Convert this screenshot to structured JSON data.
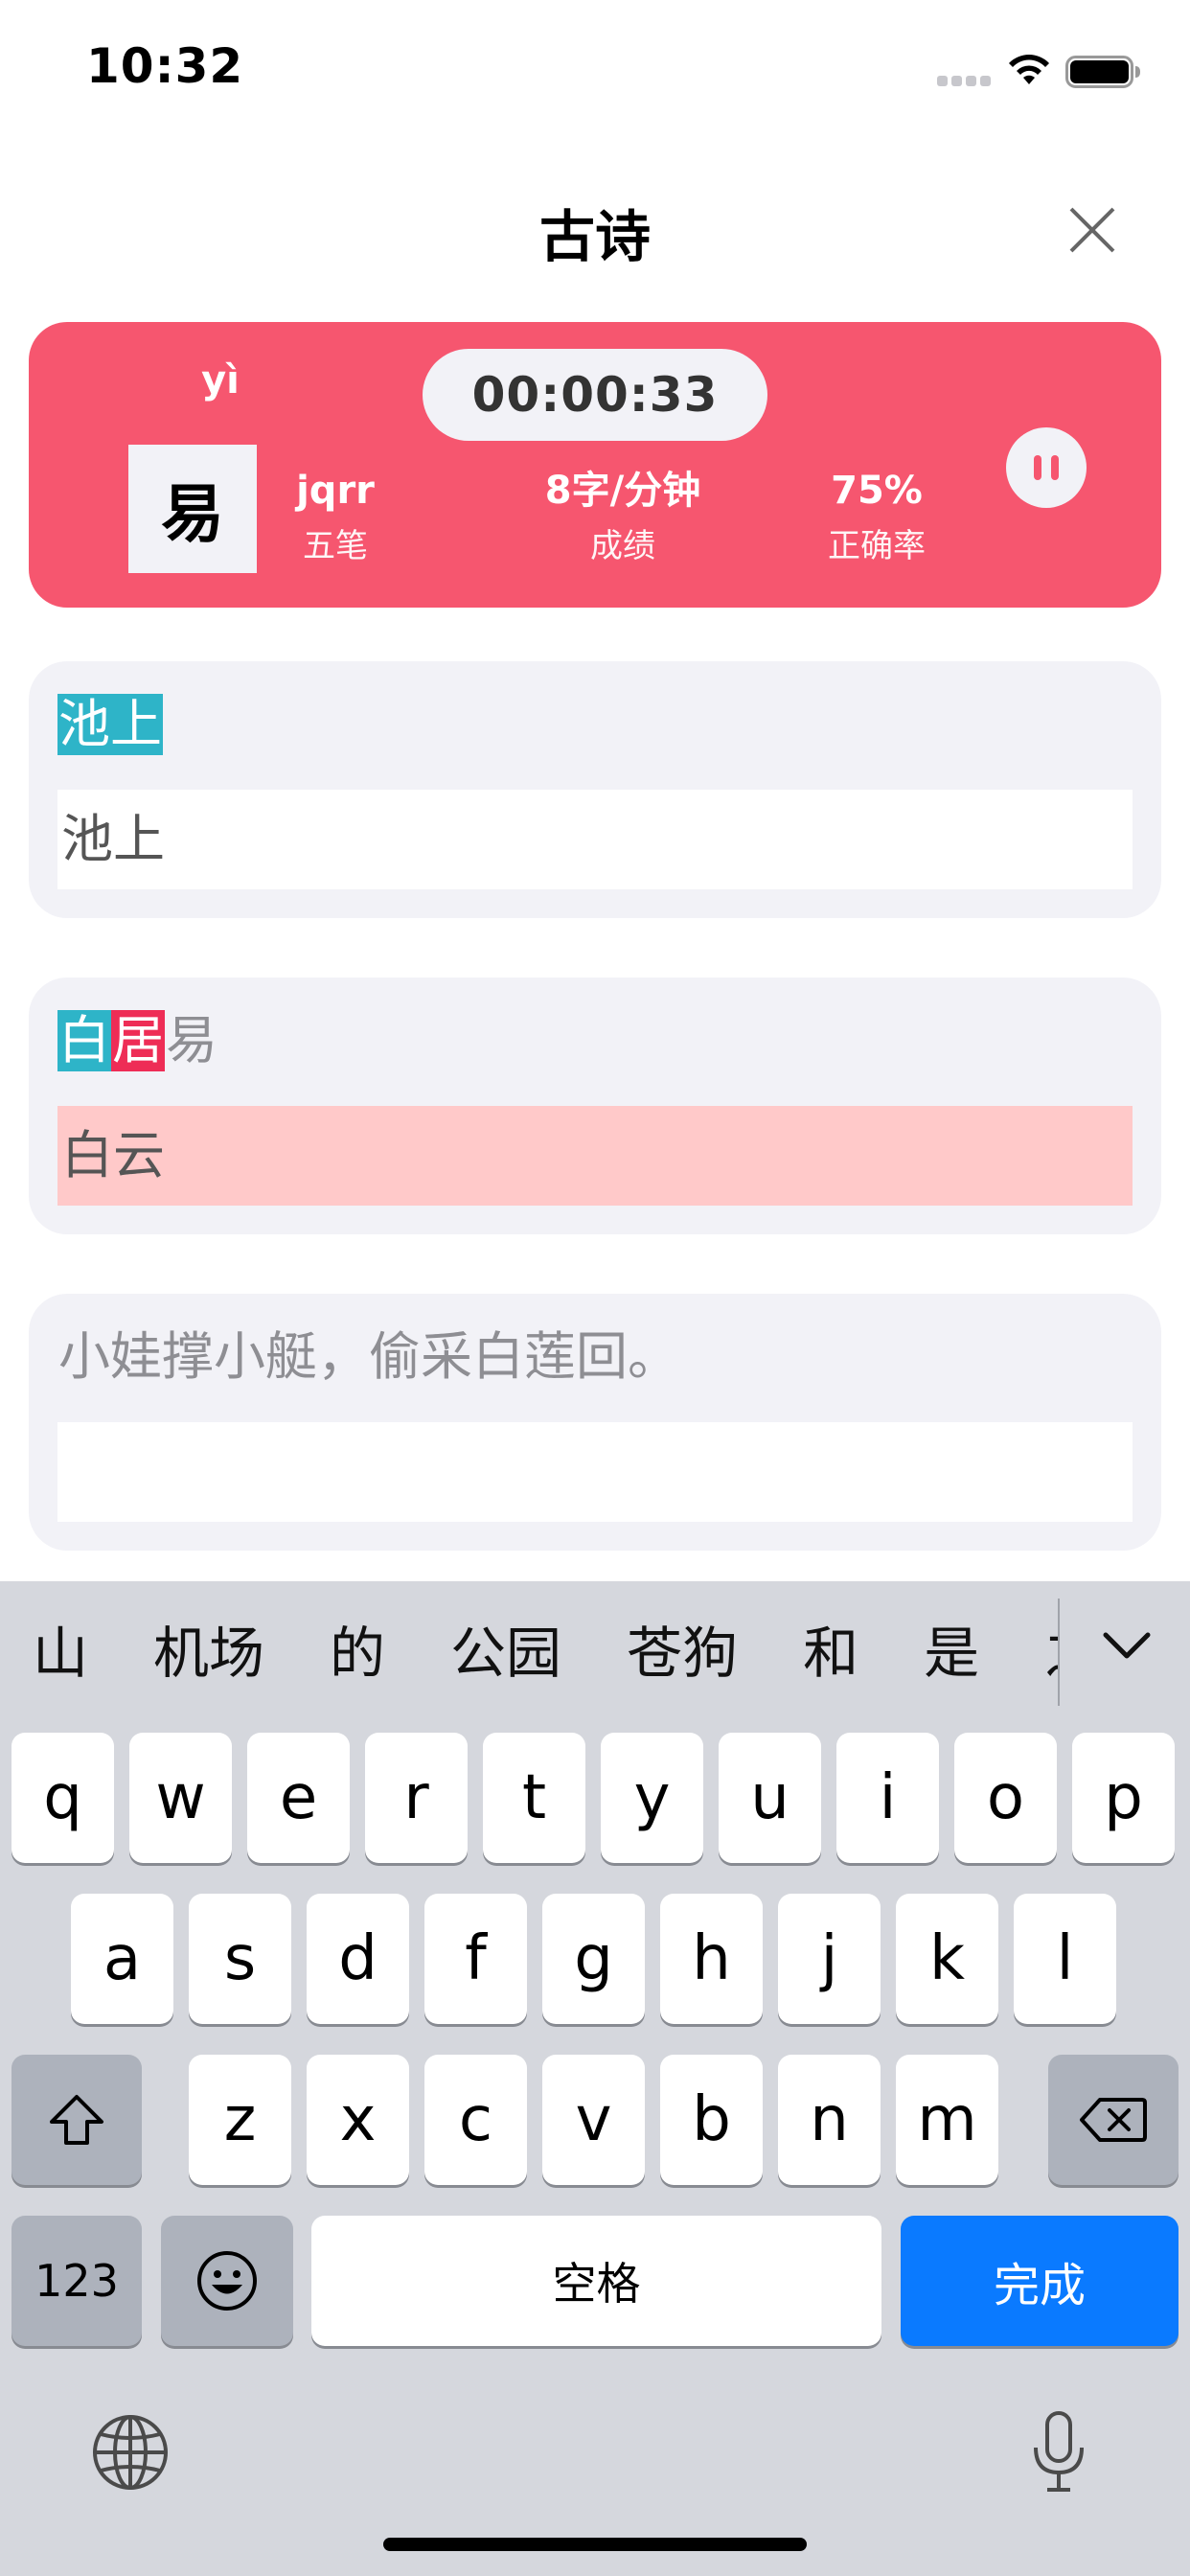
{
  "status": {
    "time": "10:32"
  },
  "nav": {
    "title": "古诗"
  },
  "stats": {
    "pinyin": "yì",
    "current_char": "易",
    "timer": "00:00:33",
    "code": "jqrr",
    "code_label": "五笔",
    "speed": "8字/分钟",
    "speed_label": "成绩",
    "accuracy": "75%",
    "accuracy_label": "正确率"
  },
  "lines": [
    {
      "segments": [
        {
          "text": "池上",
          "state": "ok"
        }
      ],
      "input": "池上",
      "input_state": "normal"
    },
    {
      "segments": [
        {
          "text": "白",
          "state": "ok"
        },
        {
          "text": "居",
          "state": "bad"
        },
        {
          "text": "易",
          "state": "todo"
        }
      ],
      "input": "白云",
      "input_state": "error"
    },
    {
      "segments": [
        {
          "text": "小娃撑小艇，偷采白莲回。",
          "state": "todo"
        }
      ],
      "input": "",
      "input_state": "normal"
    }
  ],
  "keyboard": {
    "candidates": [
      "山",
      "机场",
      "的",
      "公园",
      "苍狗",
      "和",
      "是",
      "之"
    ],
    "row1": [
      "q",
      "w",
      "e",
      "r",
      "t",
      "y",
      "u",
      "i",
      "o",
      "p"
    ],
    "row2": [
      "a",
      "s",
      "d",
      "f",
      "g",
      "h",
      "j",
      "k",
      "l"
    ],
    "row3": [
      "z",
      "x",
      "c",
      "v",
      "b",
      "n",
      "m"
    ],
    "numbers_label": "123",
    "space_label": "空格",
    "done_label": "完成"
  },
  "colors": {
    "card": "#f6566f",
    "correct": "#2eb4c8",
    "wrong": "#ee2d56",
    "error_input": "#ffc9c9",
    "done_key": "#0a7aff"
  }
}
